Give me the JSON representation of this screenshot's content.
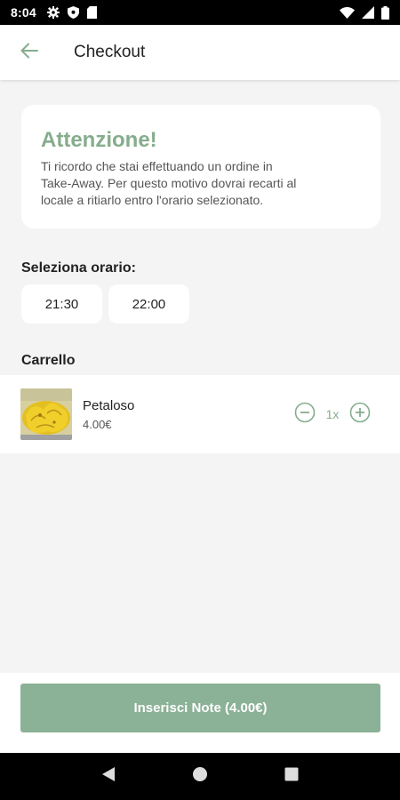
{
  "status_bar": {
    "time": "8:04",
    "left_icons": [
      "gear-icon",
      "shield-icon",
      "sim-card-icon"
    ],
    "right_icons": [
      "wifi-icon",
      "signal-icon",
      "battery-icon"
    ]
  },
  "app_bar": {
    "title": "Checkout",
    "back_icon": "arrow-left-icon"
  },
  "alert": {
    "title": "Attenzione!",
    "line1": "Ti ricordo che stai effettuando un ordine in",
    "line2": "Take-Away. Per questo motivo dovrai recarti al",
    "line3": "locale a ritiarlo entro l'orario selezionato."
  },
  "time_selection": {
    "label": "Seleziona orario:",
    "options": [
      "21:30",
      "22:00"
    ]
  },
  "cart": {
    "label": "Carrello",
    "items": [
      {
        "name": "Petaloso",
        "price": "4.00€",
        "quantity": "1x",
        "image": "food-thumbnail"
      }
    ]
  },
  "footer": {
    "button_label": "Inserisci Note (4.00€)"
  },
  "nav_bar": {
    "buttons": [
      "back-triangle-icon",
      "home-circle-icon",
      "recents-square-icon"
    ]
  },
  "colors": {
    "accent": "#85ad8d",
    "button": "#8bb196",
    "background": "#f4f4f4"
  }
}
